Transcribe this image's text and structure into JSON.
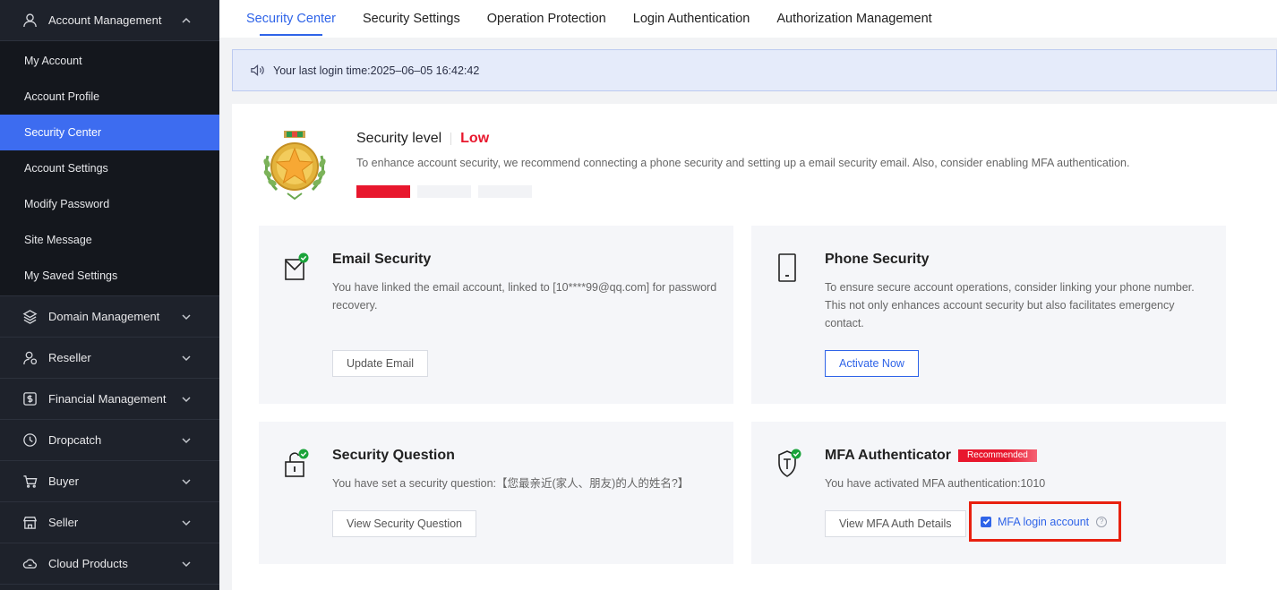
{
  "sidebar": {
    "groups_top": [
      {
        "label": "Account Management",
        "icon": "user-icon",
        "expanded": true
      }
    ],
    "sub_items": [
      {
        "label": "My Account"
      },
      {
        "label": "Account Profile"
      },
      {
        "label": "Security Center",
        "active": true
      },
      {
        "label": "Account Settings"
      },
      {
        "label": "Modify Password"
      },
      {
        "label": "Site Message"
      },
      {
        "label": "My Saved Settings"
      }
    ],
    "groups": [
      {
        "label": "Domain Management",
        "icon": "layers-icon"
      },
      {
        "label": "Reseller",
        "icon": "reseller-icon"
      },
      {
        "label": "Financial Management",
        "icon": "finance-icon"
      },
      {
        "label": "Dropcatch",
        "icon": "clock-icon"
      },
      {
        "label": "Buyer",
        "icon": "cart-icon"
      },
      {
        "label": "Seller",
        "icon": "store-icon"
      },
      {
        "label": "Cloud Products",
        "icon": "cloud-icon"
      }
    ]
  },
  "tabs": [
    {
      "label": "Security Center",
      "active": true
    },
    {
      "label": "Security Settings"
    },
    {
      "label": "Operation Protection"
    },
    {
      "label": "Login Authentication"
    },
    {
      "label": "Authorization Management"
    }
  ],
  "notice": {
    "text": "Your last login time:2025–06–05 16:42:42",
    "icon": "speaker-icon"
  },
  "security_level": {
    "title": "Security level",
    "level": "Low",
    "description": "To enhance account security, we recommend connecting a phone security and setting up a email security email. Also, consider enabling MFA authentication.",
    "bars_filled": 1,
    "bars_total": 3,
    "level_color": "#e8172d"
  },
  "cards": {
    "email": {
      "title": "Email Security",
      "description": "You have linked the email account, linked to [10****99@qq.com] for password recovery.",
      "button": "Update Email",
      "verified": true
    },
    "phone": {
      "title": "Phone Security",
      "description": "To ensure secure account operations, consider linking your phone number. This not only enhances account security but also facilitates emergency contact.",
      "button": "Activate Now",
      "verified": false
    },
    "question": {
      "title": "Security Question",
      "description": "You have set a security question:【您最亲近(家人、朋友)的人的姓名?】",
      "button": "View Security Question",
      "verified": true
    },
    "mfa": {
      "title": "MFA Authenticator",
      "badge": "Recommended",
      "description": "You have activated MFA authentication:1010",
      "button": "View MFA Auth Details",
      "checkbox_label": "MFA login account",
      "checkbox_checked": true,
      "verified": true
    }
  },
  "colors": {
    "accent": "#2f64e8",
    "danger": "#e8172d",
    "sidebar_bg": "#1e222b",
    "verified": "#1aa33a"
  }
}
